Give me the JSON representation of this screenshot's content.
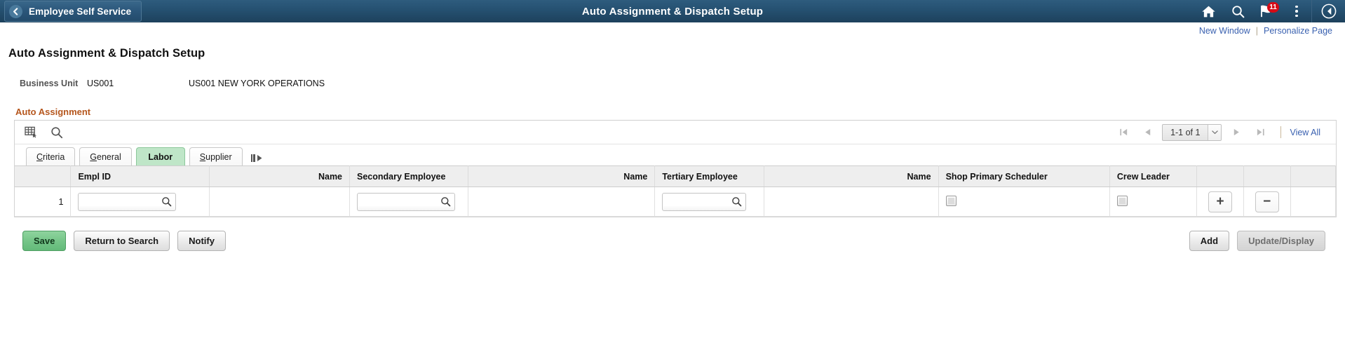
{
  "header": {
    "back_label": "Employee Self Service",
    "title": "Auto Assignment & Dispatch Setup",
    "icons": {
      "home": "home-icon",
      "search": "search-icon",
      "notifications": "flag-icon",
      "notification_count": "11",
      "actions": "more-actions-icon",
      "navigator": "navbar-navigator-icon"
    }
  },
  "linkbar": {
    "new_window": "New Window",
    "separator": "|",
    "personalize_page": "Personalize Page"
  },
  "page": {
    "title": "Auto Assignment & Dispatch Setup",
    "business_unit_label": "Business Unit",
    "business_unit_value": "US001",
    "business_unit_description": "US001 NEW YORK OPERATIONS",
    "section_title": "Auto Assignment"
  },
  "grid": {
    "toolbar": {
      "personalize_icon": "grid-personalize-icon",
      "find_icon": "find-icon",
      "first_icon": "first-page-icon",
      "prev_icon": "previous-page-icon",
      "counter": "1-1 of 1",
      "counter_dropdown_icon": "chevron-down-icon",
      "next_icon": "next-page-icon",
      "last_icon": "last-page-icon",
      "view_all": "View All"
    },
    "tabs": [
      {
        "label": "Criteria",
        "accel": "C",
        "rest": "riteria",
        "active": false
      },
      {
        "label": "General",
        "accel": "G",
        "rest": "eneral",
        "active": false
      },
      {
        "label": "Labor",
        "accel": "",
        "rest": "Labor",
        "active": true
      },
      {
        "label": "Supplier",
        "accel": "S",
        "rest": "upplier",
        "active": false
      }
    ],
    "expand_icon": "expand-all-tabs-icon",
    "columns": [
      {
        "label": "",
        "align": "left"
      },
      {
        "label": "Empl ID",
        "align": "left"
      },
      {
        "label": "Name",
        "align": "right"
      },
      {
        "label": "Secondary Employee",
        "align": "left"
      },
      {
        "label": "Name",
        "align": "right"
      },
      {
        "label": "Tertiary Employee",
        "align": "left"
      },
      {
        "label": "Name",
        "align": "right"
      },
      {
        "label": "Shop Primary Scheduler",
        "align": "left"
      },
      {
        "label": "Crew Leader",
        "align": "left"
      },
      {
        "label": "",
        "align": "left"
      },
      {
        "label": "",
        "align": "left"
      },
      {
        "label": "",
        "align": "left"
      }
    ],
    "rows": [
      {
        "num": "1",
        "empl_id": "",
        "empl_id_placeholder": "",
        "name": "",
        "secondary_employee": "",
        "secondary_name": "",
        "tertiary_employee": "",
        "tertiary_name": "",
        "shop_primary_scheduler_checked": false,
        "crew_leader_checked": false,
        "add_row_label": "+",
        "delete_row_label": "−"
      }
    ]
  },
  "footer": {
    "save": "Save",
    "return_to_search": "Return to Search",
    "notify": "Notify",
    "add": "Add",
    "update_display": "Update/Display"
  }
}
